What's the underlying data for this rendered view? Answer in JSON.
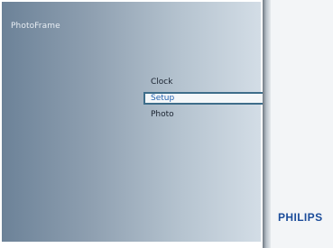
{
  "app": {
    "title": "PhotoFrame"
  },
  "menu": {
    "items": [
      {
        "label": "Clock",
        "selected": false
      },
      {
        "label": "Setup",
        "selected": true
      },
      {
        "label": "Photo",
        "selected": false
      }
    ]
  },
  "brand": {
    "logo_text": "PHILIPS",
    "color": "#1b4c9a"
  },
  "colors": {
    "selection_border": "#3e6d8a",
    "selection_text": "#1f5fae"
  }
}
